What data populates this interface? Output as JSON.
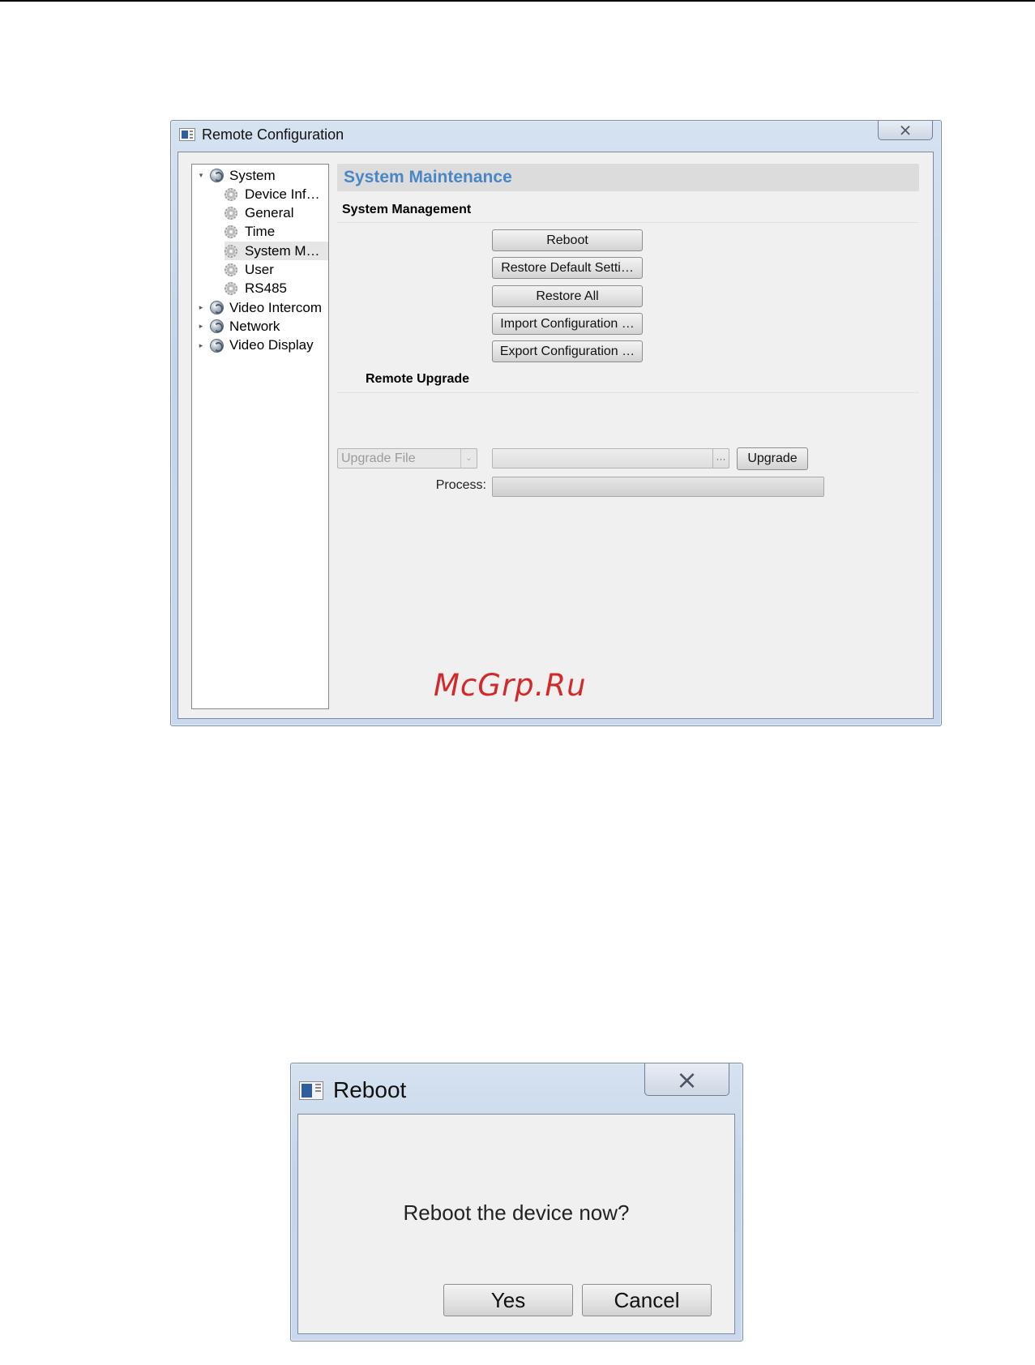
{
  "remote_config": {
    "title": "Remote Configuration",
    "close_glyph": "⨯",
    "tree": [
      {
        "label": "System",
        "expander": "▾",
        "icon": "globe-icon"
      },
      {
        "label": "Device Inf…",
        "icon": "gear-icon"
      },
      {
        "label": "General",
        "icon": "gear-icon"
      },
      {
        "label": "Time",
        "icon": "gear-icon"
      },
      {
        "label": "System M…",
        "icon": "gear-icon",
        "selected": true
      },
      {
        "label": "User",
        "icon": "gear-icon"
      },
      {
        "label": "RS485",
        "icon": "gear-icon"
      },
      {
        "label": "Video Intercom",
        "expander": "▸",
        "icon": "globe-icon"
      },
      {
        "label": "Network",
        "expander": "▸",
        "icon": "globe-icon"
      },
      {
        "label": "Video Display",
        "expander": "▸",
        "icon": "globe-icon"
      }
    ],
    "panel_title": "System Maintenance",
    "system_management": {
      "label": "System Management",
      "buttons": [
        "Reboot",
        "Restore Default Setti…",
        "Restore All",
        "Import Configuration …",
        "Export Configuration …"
      ]
    },
    "remote_upgrade": {
      "label": "Remote Upgrade",
      "type_select": {
        "value": "Upgrade File",
        "arrow": "⌄"
      },
      "file_path": {
        "value": "",
        "browse": "···"
      },
      "upgrade_button": "Upgrade",
      "process_label": "Process:",
      "progress": 0
    }
  },
  "watermark": "McGrp.Ru",
  "reboot_dialog": {
    "title": "Reboot",
    "close_glyph": "⨯",
    "message": "Reboot the device now?",
    "yes": "Yes",
    "cancel": "Cancel"
  },
  "colors": {
    "panel_title": "#4a86c6",
    "watermark": "#d22a2a",
    "window_frame": "#c4d5ea"
  }
}
